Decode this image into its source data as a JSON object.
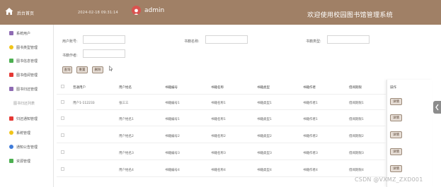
{
  "header": {
    "home_label": "后台首页",
    "datetime": "2024-02-18 09:31:14",
    "username": "admin",
    "site_title": "欢迎使用校园图书馆管理系统",
    "colors": {
      "bar": "#a08066",
      "accent": "#d9534f"
    }
  },
  "sidebar": {
    "items": [
      {
        "label": "系统用户",
        "icon": "user-icon",
        "color": "#8e6bb3"
      },
      {
        "label": "图书类型管理",
        "icon": "tag-icon",
        "color": "#f0c419"
      },
      {
        "label": "图书信息管理",
        "icon": "book-icon",
        "color": "#4caf50"
      },
      {
        "label": "图书借阅管理",
        "icon": "borrow-icon",
        "color": "#e53935"
      },
      {
        "label": "图书归还管理",
        "icon": "return-icon",
        "color": "#8e6bb3"
      },
      {
        "label": "图书归还列表",
        "icon": "",
        "color": ""
      },
      {
        "label": "归还通知管理",
        "icon": "notice-icon",
        "color": "#e53935"
      },
      {
        "label": "系统管理",
        "icon": "settings-icon",
        "color": "#f0c419"
      },
      {
        "label": "通知公告管理",
        "icon": "announcement-icon",
        "color": "#3f7bd9"
      },
      {
        "label": "资源管理",
        "icon": "resource-icon",
        "color": "#4caf50"
      }
    ]
  },
  "filters": {
    "user_account_label": "用户账号:",
    "book_name_label": "书籍名称:",
    "book_type_label": "书籍类型:",
    "book_author_label": "书籍作者:",
    "buttons": {
      "search": "查询",
      "reset": "重置",
      "delete": "删除"
    }
  },
  "table": {
    "headers": [
      "普通用户",
      "用户姓名",
      "书籍编号",
      "书籍名称",
      "书籍类型",
      "书籍作者",
      "借阅期限",
      "操作"
    ],
    "rows": [
      {
        "account": "用户1-112233",
        "name": "张三三",
        "code": "书籍编号1",
        "title": "书籍名称1",
        "type": "书籍类型1",
        "author": "书籍作者1",
        "period": "借阅期限1"
      },
      {
        "account": "",
        "name": "用户姓名1",
        "code": "书籍编号1",
        "title": "书籍名称1",
        "type": "书籍类型1",
        "author": "书籍作者1",
        "period": "借阅期限1"
      },
      {
        "account": "",
        "name": "用户姓名2",
        "code": "书籍编号2",
        "title": "书籍名称2",
        "type": "书籍类型2",
        "author": "书籍作者2",
        "period": "借阅期限2"
      },
      {
        "account": "",
        "name": "用户姓名3",
        "code": "书籍编号3",
        "title": "书籍名称3",
        "type": "书籍类型3",
        "author": "书籍作者3",
        "period": "借阅期限3"
      },
      {
        "account": "",
        "name": "用户姓名4",
        "code": "书籍编号4",
        "title": "书籍名称4",
        "type": "书籍类型4",
        "author": "书籍作者4",
        "period": "借阅期限4"
      }
    ],
    "detail_label": "详情"
  },
  "watermark": "CSDN @VXMZ_ZXD001"
}
